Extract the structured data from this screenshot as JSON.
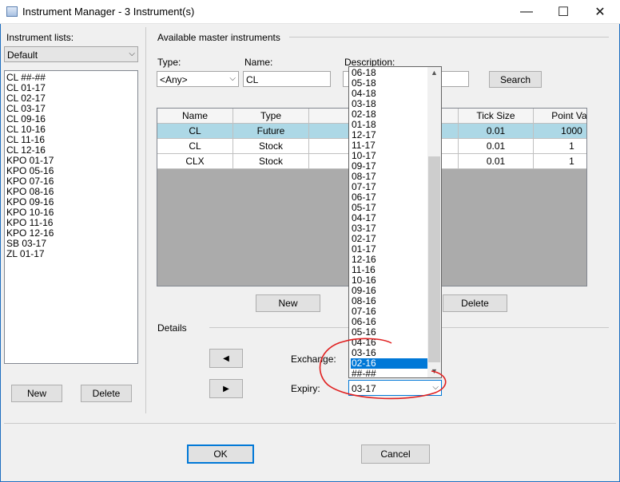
{
  "window": {
    "title": "Instrument Manager - 3 Instrument(s)",
    "minimize_glyph": "—",
    "maximize_glyph": "☐",
    "close_glyph": "✕"
  },
  "left": {
    "lists_label": "Instrument lists:",
    "list_combo_value": "Default",
    "items": [
      "CL ##-##",
      "CL 01-17",
      "CL 02-17",
      "CL 03-17",
      "CL 09-16",
      "CL 10-16",
      "CL 11-16",
      "CL 12-16",
      "KPO 01-17",
      "KPO 05-16",
      "KPO 07-16",
      "KPO 08-16",
      "KPO 09-16",
      "KPO 10-16",
      "KPO 11-16",
      "KPO 12-16",
      "SB 03-17",
      "ZL 01-17"
    ],
    "new_label": "New",
    "delete_label": "Delete"
  },
  "master": {
    "heading": "Available master instruments",
    "type_label": "Type:",
    "type_value": "<Any>",
    "name_label": "Name:",
    "name_value": "CL",
    "description_label": "Description:",
    "description_value": "",
    "search_label": "Search",
    "columns": {
      "name": "Name",
      "type": "Type",
      "tick_size": "Tick Size",
      "point_val": "Point Val."
    },
    "rows": [
      {
        "name": "CL",
        "type": "Future",
        "tick_size": "0.01",
        "point_val": "1000"
      },
      {
        "name": "CL",
        "type": "Stock",
        "tick_size": "0.01",
        "point_val": "1"
      },
      {
        "name": "CLX",
        "type": "Stock",
        "tick_size": "0.01",
        "point_val": "1"
      }
    ],
    "selected_row": 0,
    "new_label": "New",
    "delete_label": "Delete"
  },
  "details": {
    "heading": "Details",
    "move_left_glyph": "◀",
    "move_right_glyph": "▶",
    "exchange_label": "Exchange:",
    "expiry_label": "Expiry:",
    "expiry_value": "03-17"
  },
  "expiry_dropdown": {
    "options": [
      "06-18",
      "05-18",
      "04-18",
      "03-18",
      "02-18",
      "01-18",
      "12-17",
      "11-17",
      "10-17",
      "09-17",
      "08-17",
      "07-17",
      "06-17",
      "05-17",
      "04-17",
      "03-17",
      "02-17",
      "01-17",
      "12-16",
      "11-16",
      "10-16",
      "09-16",
      "08-16",
      "07-16",
      "06-16",
      "05-16",
      "04-16",
      "03-16",
      "02-16",
      "##-##"
    ],
    "highlighted": "02-16",
    "scroll_up_glyph": "▲",
    "scroll_down_glyph": "▼"
  },
  "footer": {
    "ok_label": "OK",
    "cancel_label": "Cancel"
  },
  "annotation": {
    "color": "#e02020"
  },
  "colors": {
    "selection": "#0078d7",
    "row_selected": "#add8e6",
    "grid_empty": "#ababab"
  }
}
